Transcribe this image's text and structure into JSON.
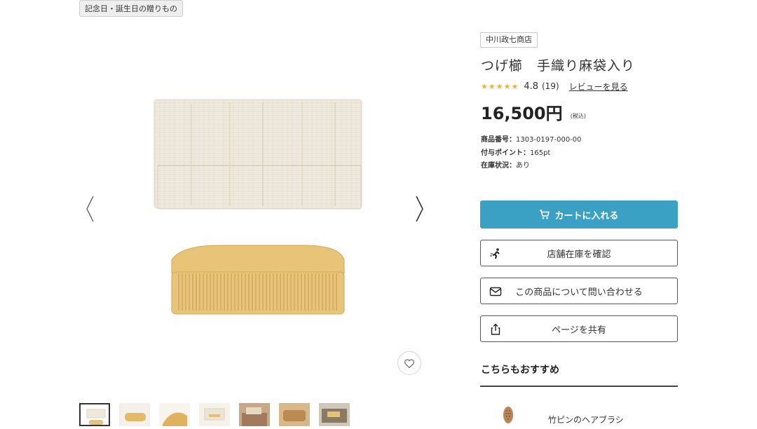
{
  "category_tag": "記念日・誕生日の贈りもの",
  "gallery": {
    "prev_arrow": "〈",
    "next_arrow": "〉",
    "favorite_icon": "heart-icon",
    "thumbnail_count": 7
  },
  "product": {
    "brand": "中川政七商店",
    "title": "つげ櫛　手織り麻袋入り",
    "stars": "★★★★★",
    "rating": "4.8",
    "review_count": "(19)",
    "review_link": "レビューを見る",
    "price": "16,500円",
    "tax_note": "(税込)",
    "sku_label": "商品番号：",
    "sku_value": "1303-0197-000-00",
    "points_label": "付与ポイント：",
    "points_value": "165pt",
    "stock_label": "在庫状況：",
    "stock_value": "あり"
  },
  "actions": {
    "cart": "カートに入れる",
    "store_stock": "店舗在庫を確認",
    "inquiry": "この商品について問い合わせる",
    "share": "ページを共有"
  },
  "recommend": {
    "heading": "こちらもおすすめ",
    "item_name": "竹ピンのヘアブラシ"
  },
  "colors": {
    "cart_button": "#3aa0c4",
    "star": "#e7b33e",
    "comb_wood": "#e8c478",
    "pouch_linen": "#efeadd"
  }
}
